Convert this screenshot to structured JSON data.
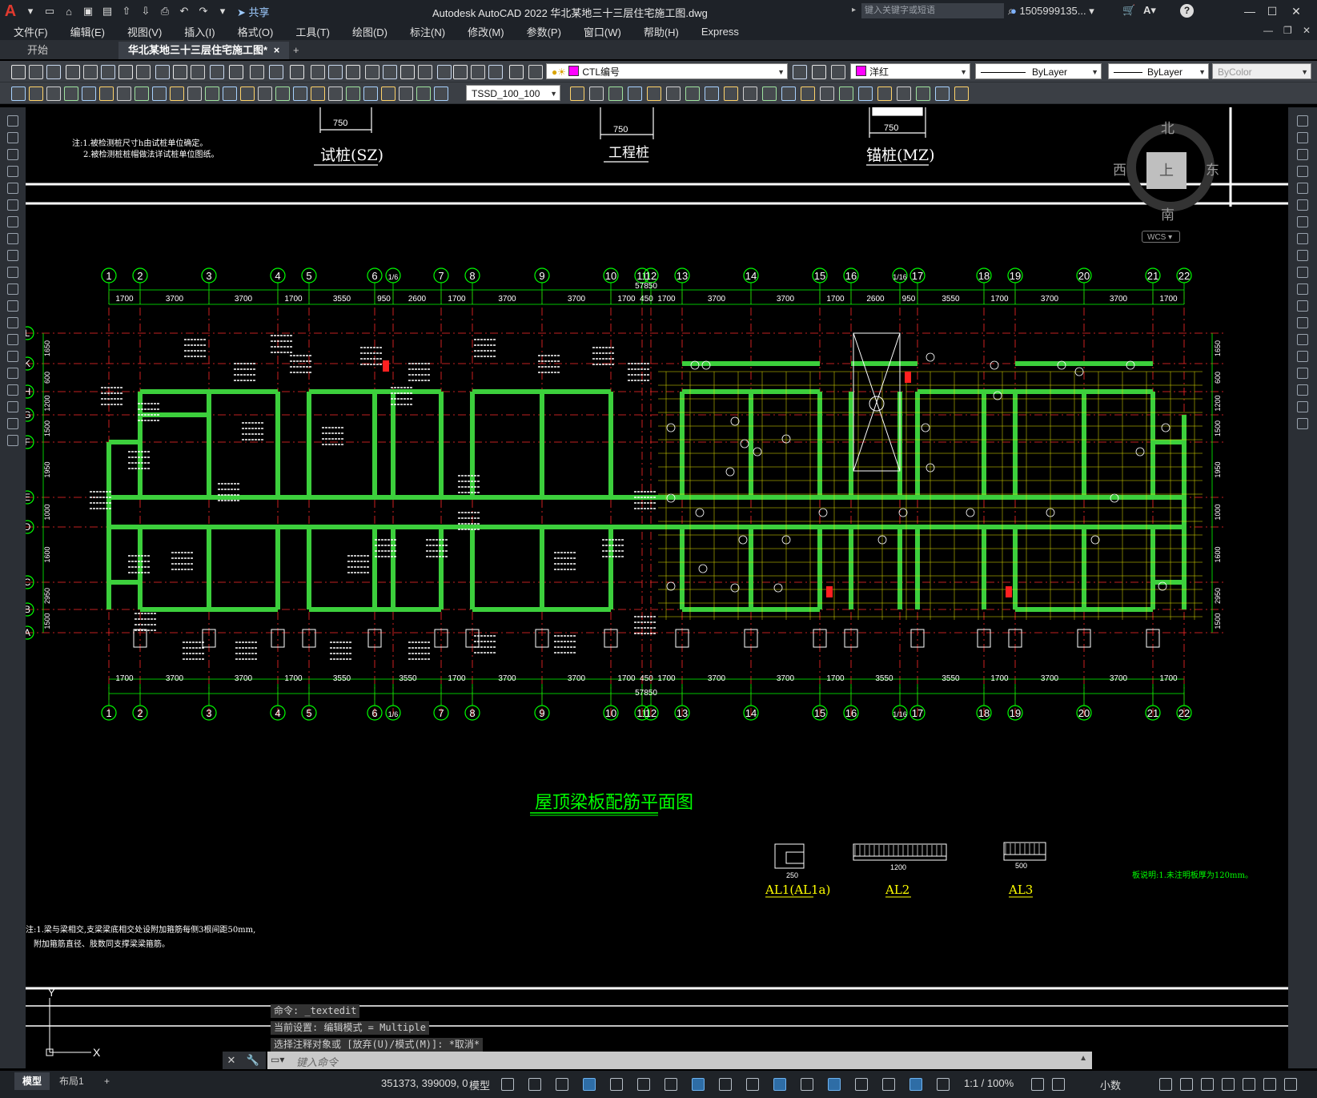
{
  "app": {
    "logo": "A",
    "title": "Autodesk AutoCAD 2022    华北某地三十三层住宅施工图.dwg",
    "share_label": "共享",
    "search_placeholder": "键入关键字或短语",
    "user": "1505999135...",
    "help": "?"
  },
  "menu": [
    "文件(F)",
    "编辑(E)",
    "视图(V)",
    "插入(I)",
    "格式(O)",
    "工具(T)",
    "绘图(D)",
    "标注(N)",
    "修改(M)",
    "参数(P)",
    "窗口(W)",
    "帮助(H)",
    "Express"
  ],
  "tabs": {
    "start": "开始",
    "file": "华北某地三十三层住宅施工图*",
    "close": "×",
    "add": "+"
  },
  "toolbar": {
    "layer": "CTL编号",
    "color": "洋红",
    "linetype": "ByLayer",
    "lineweight": "ByLayer",
    "plotstyle": "ByColor",
    "textstyle": "TSSD_100_100"
  },
  "viewcube": {
    "north": "北",
    "south": "南",
    "east": "东",
    "west": "西",
    "face": "上",
    "wcs": "WCS"
  },
  "drawing": {
    "notes_top": [
      "注:1.被检测桩尺寸h由试桩单位确定。",
      "2.被检测桩桩帽做法详试桩单位图纸。"
    ],
    "pile_labels": [
      "试桩(SZ)",
      "工程桩",
      "锚桩(MZ)"
    ],
    "pile_dims": [
      "750",
      "750",
      "750"
    ],
    "plan_title": "屋顶梁板配筋平面图",
    "grid_columns": [
      "1",
      "2",
      "3",
      "4",
      "5",
      "6",
      "1/6",
      "7",
      "8",
      "9",
      "10",
      "11",
      "12",
      "13",
      "14",
      "15",
      "16",
      "1/16",
      "17",
      "18",
      "19",
      "20",
      "21",
      "22"
    ],
    "grid_rows": [
      "L",
      "K",
      "H",
      "G",
      "F",
      "E",
      "D",
      "C",
      "B",
      "A"
    ],
    "dims_top": [
      "1700",
      "3700",
      "3700",
      "1700",
      "3550",
      "950",
      "2600",
      "1700",
      "3700",
      "3700",
      "1700",
      "450",
      "1700",
      "3700",
      "3700",
      "1700",
      "2600",
      "950",
      "3550",
      "1700",
      "3700",
      "3700",
      "1700"
    ],
    "dims_bottom": [
      "1700",
      "3700",
      "3700",
      "1700",
      "3550",
      "3550",
      "1700",
      "3700",
      "3700",
      "1700",
      "450",
      "1700",
      "3700",
      "3700",
      "1700",
      "3550",
      "3550",
      "1700",
      "3700",
      "3700",
      "1700"
    ],
    "total_dim": "57850",
    "row_dims": [
      "1650",
      "600",
      "1200",
      "1500",
      "1950",
      "1000",
      "1600",
      "2950",
      "1500",
      "1200"
    ],
    "detail_labels": [
      "AL1(AL1a)",
      "AL2",
      "AL3"
    ],
    "detail_dims": [
      "250",
      "1200",
      "500"
    ],
    "note_right": "板说明:1.未注明板厚为120mm。",
    "notes_bottom": [
      "注:1.梁与梁相交,支梁梁底相交处设附加箍筋每侧3根间距50mm,",
      "附加箍筋直径、肢数同支撑梁梁箍筋。"
    ]
  },
  "command": {
    "history": [
      "命令: _textedit",
      "当前设置: 编辑模式 = Multiple",
      "选择注释对象或 [放弃(U)/模式(M)]: *取消*"
    ],
    "placeholder": "键入命令"
  },
  "status": {
    "layout_tabs": [
      "模型",
      "布局1"
    ],
    "add": "+",
    "coords": "351373, 399009, 0",
    "model": "模型",
    "scale": "1:1 / 100%",
    "units": "小数"
  },
  "ucs": {
    "y": "Y",
    "x": "X"
  }
}
